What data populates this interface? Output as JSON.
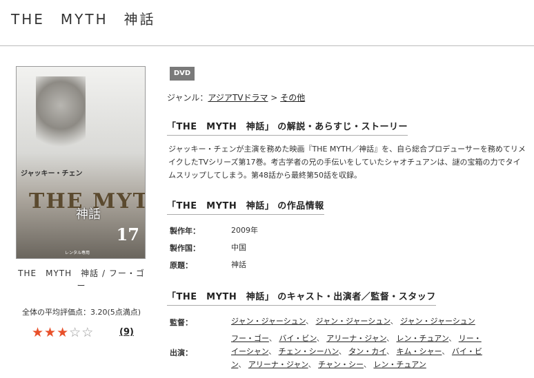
{
  "page": {
    "title": "THE　MYTH　神話"
  },
  "product": {
    "name": "THE　MYTH　神話 / フー・ゴー",
    "cover": {
      "cast_text": "ジャッキー・チェン",
      "logo_text": "THE MYTH",
      "logo_kanji": "神話",
      "volume": "17",
      "rental_text": "レンタル専用"
    },
    "rating_text": "全体の平均評価点：3.20(5点満点)",
    "rating_value": 3.2,
    "rating_max": 5,
    "review_count": "(9)"
  },
  "badge": "DVD",
  "genre": {
    "label": "ジャンル：",
    "items": [
      "アジアTVドラマ",
      "その他"
    ],
    "sep": ">"
  },
  "sections": {
    "synopsis_title": "「THE　MYTH　神話」 の解説・あらすじ・ストーリー",
    "synopsis_text": "ジャッキー・チェンが主演を務めた映画『THE MYTH／神話』を、自ら総合プロデューサーを務めてリメイクしたTVシリーズ第17巻。考古学者の兄の手伝いをしていたシャオチュアンは、謎の宝箱の力でタイムスリップしてしまう。第48話から最終第50話を収録。",
    "info_title": "「THE　MYTH　神話」 の作品情報",
    "cast_title": "「THE　MYTH　神話」 のキャスト・出演者／監督・スタッフ"
  },
  "info": [
    {
      "label": "製作年：",
      "value": "2009年"
    },
    {
      "label": "製作国：",
      "value": "中国"
    },
    {
      "label": "原題：",
      "value": "神話"
    }
  ],
  "staff": {
    "director_label": "監督：",
    "directors": [
      "ジャン・ジャーシュン",
      "ジャン・ジャーシュン",
      "ジャン・ジャーシュン"
    ],
    "cast_label": "出演：",
    "cast_line1": [
      "フー・ゴー",
      "バイ・ビン",
      "アリーナ・ジャン",
      "レン・チュアン",
      "リー・"
    ],
    "cast_line2": [
      "イーシャン",
      "チェン・シーハン",
      "タン・カイ",
      "キム・シャー",
      "バイ・ビ"
    ],
    "cast_line3": [
      "ン",
      "アリーナ・ジャン",
      "チャン・シー",
      "レン・チュアン"
    ],
    "sep": "、"
  }
}
